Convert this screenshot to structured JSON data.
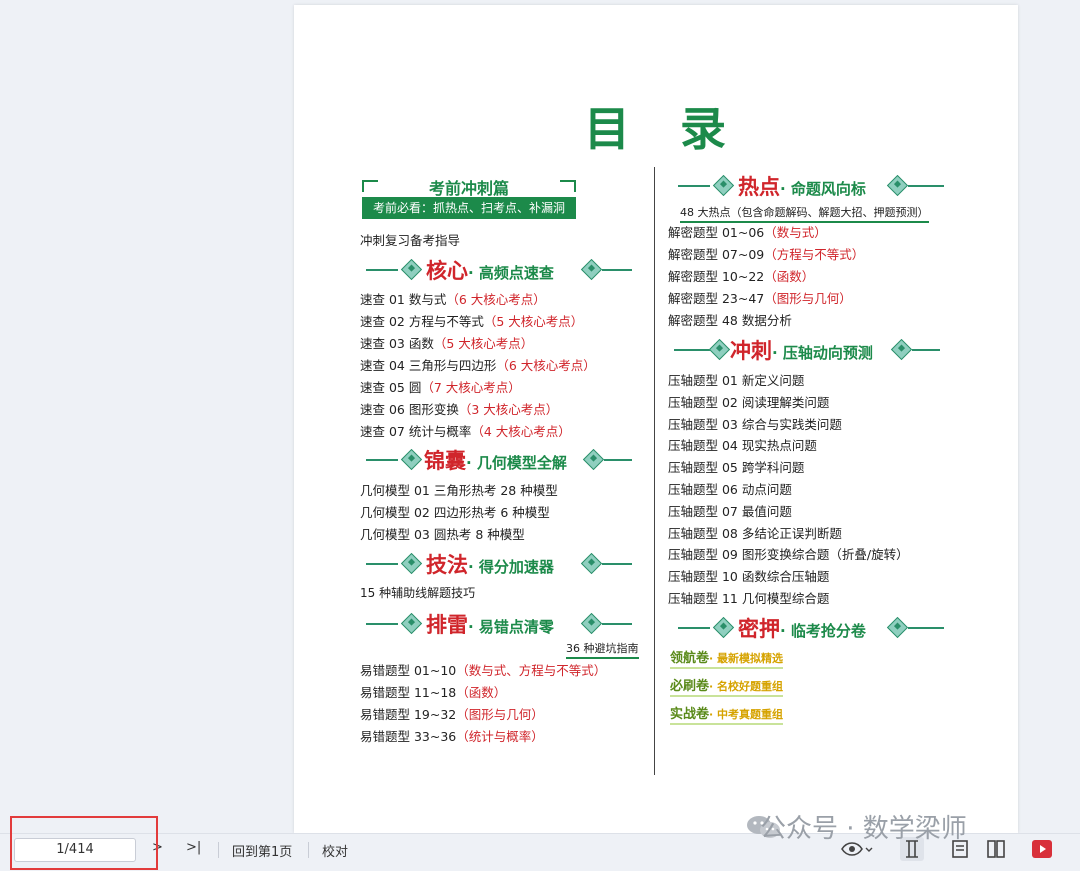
{
  "page": {
    "title": "目　录",
    "left": {
      "kq_title": "考前冲刺篇",
      "kq_subtitle": "考前必看：抓热点、扫考点、补漏洞",
      "guide": "冲刺复习备考指导",
      "sec_core": {
        "red": "核心",
        "green": "· 高频点速查"
      },
      "core_items": [
        {
          "text": "速查 01 数与式",
          "note": "（6 大核心考点）"
        },
        {
          "text": "速查 02 方程与不等式",
          "note": "（5 大核心考点）"
        },
        {
          "text": "速查 03 函数",
          "note": "（5 大核心考点）"
        },
        {
          "text": "速查 04 三角形与四边形",
          "note": "（6 大核心考点）"
        },
        {
          "text": "速查 05 圆",
          "note": "（7 大核心考点）"
        },
        {
          "text": "速查 06 图形变换",
          "note": "（3 大核心考点）"
        },
        {
          "text": "速查 07 统计与概率",
          "note": "（4 大核心考点）"
        }
      ],
      "sec_jn": {
        "red": "锦囊",
        "green": "· 几何模型全解"
      },
      "jn_items": [
        "几何模型 01 三角形热考 28 种模型",
        "几何模型 02 四边形热考 6 种模型",
        "几何模型 03 圆热考 8 种模型"
      ],
      "sec_jf": {
        "red": "技法",
        "green": "· 得分加速器"
      },
      "jf_item": "15 种辅助线解题技巧",
      "sec_pl": {
        "red": "排雷",
        "green": "· 易错点清零"
      },
      "pl_note": "36 种避坑指南",
      "pl_items": [
        {
          "text": "易错题型 01~10",
          "note": "（数与式、方程与不等式）"
        },
        {
          "text": "易错题型 11~18",
          "note": "（函数）"
        },
        {
          "text": "易错题型 19~32",
          "note": "（图形与几何）"
        },
        {
          "text": "易错题型 33~36",
          "note": "（统计与概率）"
        }
      ]
    },
    "right": {
      "sec_rd": {
        "red": "热点",
        "green": "· 命题风向标"
      },
      "rd_note": "48 大热点（包含命题解码、解题大招、押题预测）",
      "rd_items": [
        {
          "text": "解密题型 01~06",
          "note": "（数与式）"
        },
        {
          "text": "解密题型 07~09",
          "note": "（方程与不等式）"
        },
        {
          "text": "解密题型 10~22",
          "note": "（函数）"
        },
        {
          "text": "解密题型 23~47",
          "note": "（图形与几何）"
        },
        {
          "text": "解密题型 48 数据分析",
          "note": ""
        }
      ],
      "sec_cc": {
        "red": "冲刺",
        "green": "· 压轴动向预测"
      },
      "cc_items": [
        "压轴题型 01 新定义问题",
        "压轴题型 02 阅读理解类问题",
        "压轴题型 03 综合与实践类问题",
        "压轴题型 04 现实热点问题",
        "压轴题型 05 跨学科问题",
        "压轴题型 06 动点问题",
        "压轴题型 07 最值问题",
        "压轴题型 08 多结论正误判断题",
        "压轴题型 09 图形变换综合题（折叠/旋转）",
        "压轴题型 10 函数综合压轴题",
        "压轴题型 11 几何模型综合题"
      ],
      "sec_my": {
        "red": "密押",
        "green": "· 临考抢分卷"
      },
      "papers": [
        {
          "a": "领航卷",
          "b": "· 最新模拟精选"
        },
        {
          "a": "必刷卷",
          "b": "· 名校好题重组"
        },
        {
          "a": "实战卷",
          "b": "· 中考真题重组"
        }
      ]
    }
  },
  "statusbar": {
    "page_indicator": "1/414",
    "next_label": ">",
    "last_label": ">|",
    "back_first": "回到第1页",
    "proofread": "校对"
  },
  "watermark": "公众号 · 数学梁师",
  "colors": {
    "green": "#1c8a4a",
    "red": "#d0252b",
    "highlight": "#e23b3b"
  }
}
